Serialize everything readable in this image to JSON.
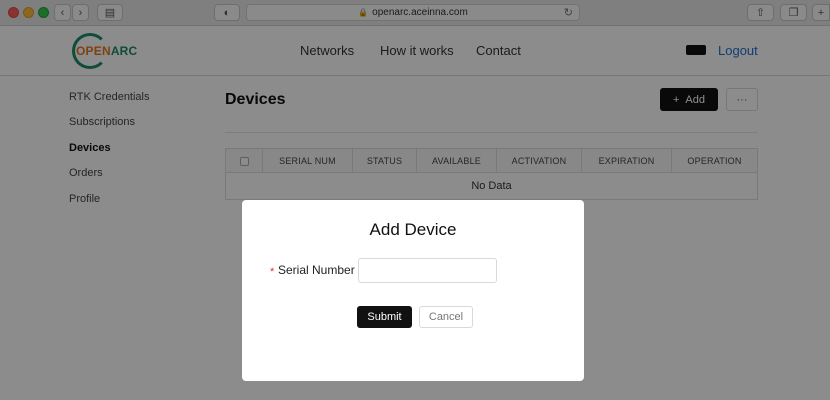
{
  "browser": {
    "url": "openarc.aceinna.com",
    "icons": [
      "back-icon",
      "forward-icon",
      "sidebar-icon",
      "shield-icon",
      "lock-icon",
      "reload-icon",
      "share-icon",
      "tabs-icon",
      "new-tab-icon"
    ]
  },
  "header": {
    "logo": {
      "open": "OPEN",
      "arc": "ARC"
    },
    "nav": [
      "Networks",
      "How it works",
      "Contact"
    ],
    "logout": "Logout"
  },
  "sidebar": {
    "items": [
      {
        "label": "RTK Credentials"
      },
      {
        "label": "Subscriptions"
      },
      {
        "label": "Devices",
        "active": true
      },
      {
        "label": "Orders"
      },
      {
        "label": "Profile"
      }
    ]
  },
  "main": {
    "title": "Devices",
    "add_label": "Add",
    "more_label": "···",
    "table": {
      "columns": [
        "SERIAL NUM",
        "STATUS",
        "AVAILABLE",
        "ACTIVATION",
        "EXPIRATION",
        "OPERATION"
      ],
      "empty_text": "No Data"
    }
  },
  "modal": {
    "title": "Add Device",
    "required_mark": "*",
    "field_label": "Serial Number",
    "field_value": "",
    "field_placeholder": "",
    "submit": "Submit",
    "cancel": "Cancel"
  },
  "colors": {
    "primary_button": "#111111",
    "link": "#1a6fd6",
    "logo_orange": "#e07a1f",
    "logo_green": "#1c8a6a",
    "required": "#e0312b"
  }
}
